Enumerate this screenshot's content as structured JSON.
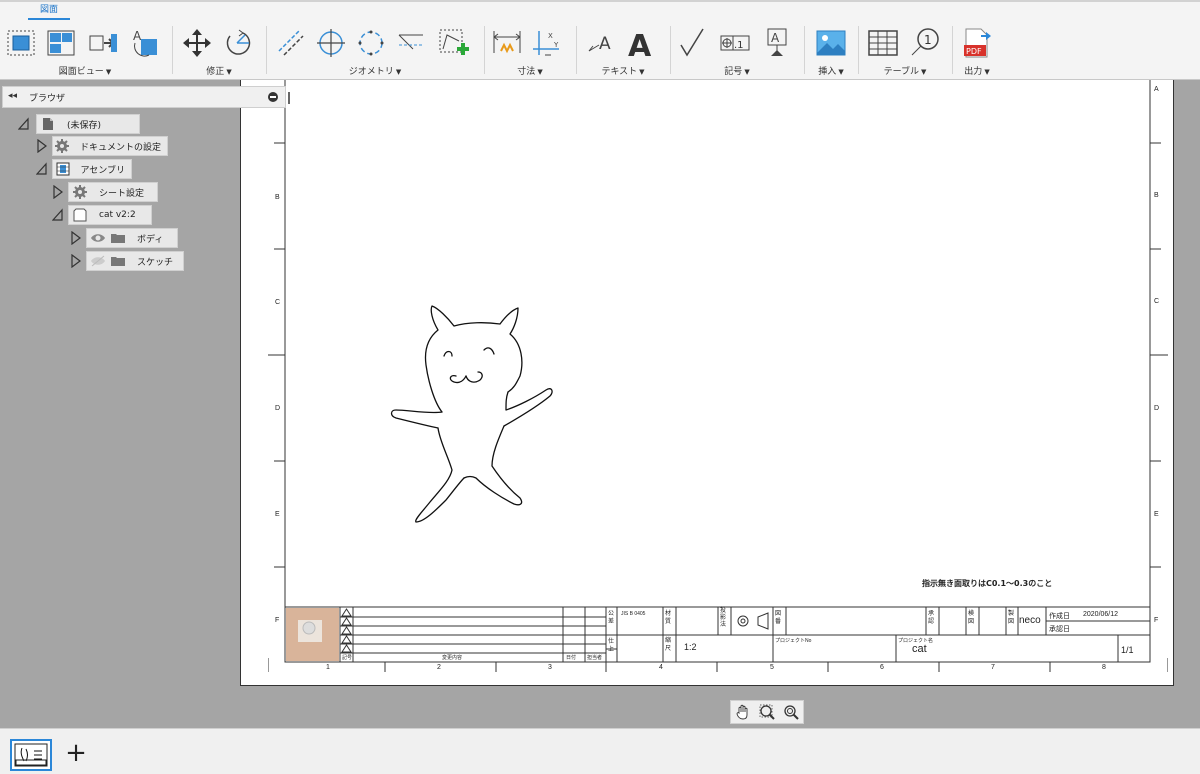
{
  "ribbon": {
    "active_tab": "図面",
    "groups": [
      {
        "label": "図面ビュー"
      },
      {
        "label": "修正"
      },
      {
        "label": "ジオメトリ"
      },
      {
        "label": "寸法"
      },
      {
        "label": "テキスト"
      },
      {
        "label": "記号"
      },
      {
        "label": "挿入"
      },
      {
        "label": "テーブル"
      },
      {
        "label": "出力"
      }
    ],
    "caret": "▼",
    "text_tool_glyph_small": "A",
    "text_tool_glyph_large": "A",
    "balloon_glyph": "1",
    "pdf_label": "PDF",
    "datum_label": "A",
    "feature_control_label": ".1",
    "dim_axis_x": "X",
    "dim_axis_y": "Y"
  },
  "browser": {
    "collapse_glyph": "◂◂",
    "title": "ブラウザ",
    "nodes": [
      {
        "label": "(未保存)"
      },
      {
        "label": "ドキュメントの設定"
      },
      {
        "label": "アセンブリ"
      },
      {
        "label": "シート設定"
      },
      {
        "label": "cat v2:2"
      },
      {
        "label": "ボディ"
      },
      {
        "label": "スケッチ"
      }
    ]
  },
  "sheet": {
    "row_labels": [
      "A",
      "B",
      "C",
      "D",
      "E",
      "F"
    ],
    "column_labels": [
      "1",
      "2",
      "3",
      "4",
      "5",
      "6",
      "7",
      "8"
    ],
    "note": "指示無き面取りはC0.1～0.3のこと",
    "title_block": {
      "kogo_label": "公差",
      "jis_label": "JIS B 0405",
      "material_label": "材質",
      "projection_label": "投影法",
      "drawing_no_label": "図番",
      "approval_label": "承認",
      "check_label": "検図",
      "drafter_label": "製図",
      "drafter": "neco",
      "created_label": "作成日",
      "created_date": "2020/06/12",
      "approved_date_label": "承認日",
      "finish_label": "仕上",
      "scale_label": "縮尺",
      "scale": "1:2",
      "project_no_label": "プロジェクトNo",
      "project_name_label": "プロジェクト名",
      "project_name": "cat",
      "sheet_count": "1/1",
      "rev_symbol_label": "記号",
      "rev_content_label": "変更内容",
      "rev_date_label": "日付",
      "rev_person_label": "担当者"
    }
  },
  "bottom": {
    "add_sheet_glyph": "+"
  }
}
